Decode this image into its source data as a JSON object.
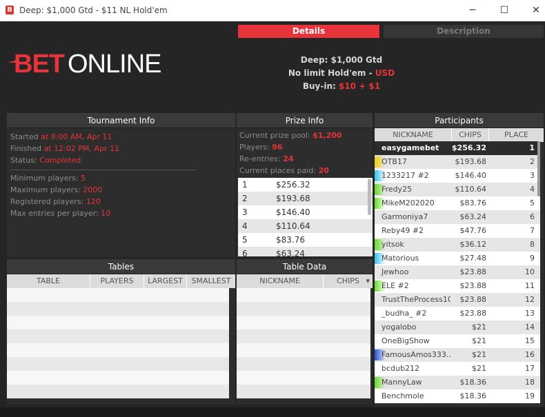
{
  "window": {
    "title": "Deep: $1,000 Gtd - $11 NL Hold'em",
    "app_icon": "B",
    "minimize_icon": "─",
    "maximize_icon": "☐",
    "close_icon": "✕"
  },
  "tabs": {
    "details": "Details",
    "description": "Description"
  },
  "brand": {
    "bet": "BET",
    "online": "ONLINE"
  },
  "header": {
    "name": "Deep: $1,000 Gtd",
    "game_prefix": "No limit Hold'em - ",
    "game_currency": "USD",
    "buyin_prefix": "Buy-in: ",
    "buyin_value": "$10 + $1"
  },
  "tournament_info": {
    "title": "Tournament Info",
    "started_label": "Started ",
    "started_value": "at 8:00 AM, Apr 11",
    "finished_label": "Finished ",
    "finished_value": "at 12:02 PM, Apr 11",
    "status_label": "Status: ",
    "status_value": "Completed",
    "min_label": "Minimum players: ",
    "min_value": "5",
    "max_label": "Maximum players: ",
    "max_value": "2000",
    "reg_label": "Registered players: ",
    "reg_value": "120",
    "maxent_label": "Max entries per player: ",
    "maxent_value": "10"
  },
  "prize_info": {
    "title": "Prize Info",
    "pool_label": "Current prize pool: ",
    "pool_value": "$1,200",
    "players_label": "Players: ",
    "players_value": "96",
    "reentries_label": "Re-entries: ",
    "reentries_value": "24",
    "places_label": "Current places paid: ",
    "places_value": "20",
    "prizes": [
      {
        "place": "1",
        "amount": "$256.32"
      },
      {
        "place": "2",
        "amount": "$193.68"
      },
      {
        "place": "3",
        "amount": "$146.40"
      },
      {
        "place": "4",
        "amount": "$110.64"
      },
      {
        "place": "5",
        "amount": "$83.76"
      },
      {
        "place": "6",
        "amount": "$63.24"
      }
    ]
  },
  "participants": {
    "title": "Participants",
    "columns": [
      "NICKNAME",
      "CHIPS",
      "PLACE"
    ],
    "rows": [
      {
        "name": "easygamebet",
        "chips": "$256.32",
        "place": "1",
        "color": ""
      },
      {
        "name": "OTB17",
        "chips": "$193.68",
        "place": "2",
        "color": "#f0d000"
      },
      {
        "name": "1233217 #2",
        "chips": "$146.40",
        "place": "3",
        "color": "#33c0ee"
      },
      {
        "name": "Fredy25",
        "chips": "$110.64",
        "place": "4",
        "color": "#66dd22"
      },
      {
        "name": "MikeM202020",
        "chips": "$83.76",
        "place": "5",
        "color": "#66dd22"
      },
      {
        "name": "Garmoniya7",
        "chips": "$63.24",
        "place": "6",
        "color": ""
      },
      {
        "name": "Reby49 #2",
        "chips": "$47.76",
        "place": "7",
        "color": ""
      },
      {
        "name": "yitsok",
        "chips": "$36.12",
        "place": "8",
        "color": "#66dd22"
      },
      {
        "name": "Matorious",
        "chips": "$27.48",
        "place": "9",
        "color": "#33c0ee"
      },
      {
        "name": "Jewhoo",
        "chips": "$23.88",
        "place": "10",
        "color": ""
      },
      {
        "name": "ELE #2",
        "chips": "$23.88",
        "place": "11",
        "color": "#66dd22"
      },
      {
        "name": "TrustTheProcess10",
        "chips": "$23.88",
        "place": "12",
        "color": ""
      },
      {
        "name": "_budha_ #2",
        "chips": "$23.88",
        "place": "13",
        "color": ""
      },
      {
        "name": "yogalobo",
        "chips": "$21",
        "place": "14",
        "color": ""
      },
      {
        "name": "OneBigShow",
        "chips": "$21",
        "place": "15",
        "color": ""
      },
      {
        "name": "FamousAmos333...",
        "chips": "$21",
        "place": "16",
        "color": "#2255dd"
      },
      {
        "name": "bcdub212",
        "chips": "$21",
        "place": "17",
        "color": ""
      },
      {
        "name": "MannyLaw",
        "chips": "$18.36",
        "place": "18",
        "color": "#66dd22"
      },
      {
        "name": "Benchmole",
        "chips": "$18.36",
        "place": "19",
        "color": ""
      }
    ]
  },
  "tables": {
    "title": "Tables",
    "columns": [
      "TABLE",
      "PLAYERS",
      "LARGEST",
      "SMALLEST"
    ]
  },
  "table_data": {
    "title": "Table Data",
    "columns": [
      "NICKNAME",
      "CHIPS"
    ],
    "sort_icon": "▾"
  }
}
